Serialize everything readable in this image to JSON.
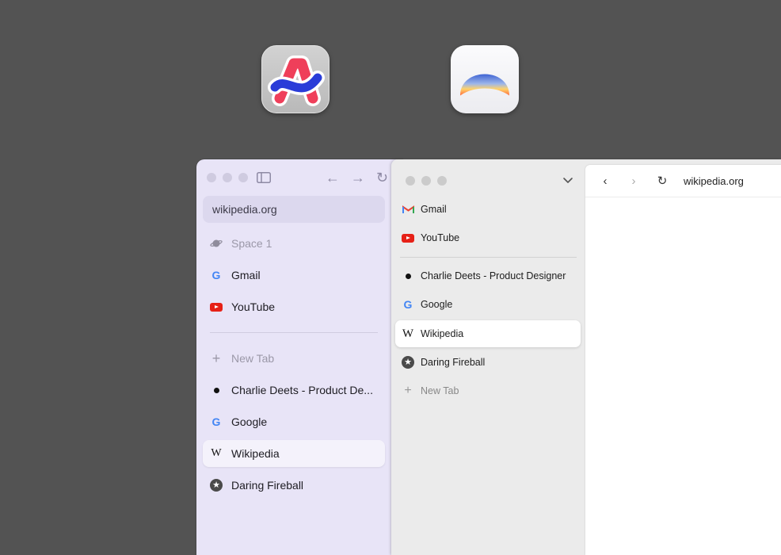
{
  "apps": {
    "arc_icon": "arc-logo-icon",
    "browser2_icon": "sunrise-logo-icon"
  },
  "win1": {
    "address": "wikipedia.org",
    "space": "Space 1",
    "pinned": [
      {
        "label": "Gmail",
        "icon": "google-icon"
      },
      {
        "label": "YouTube",
        "icon": "youtube-icon"
      }
    ],
    "new_tab": "New Tab",
    "tabs": [
      {
        "label": "Charlie Deets - Product De...",
        "icon": "bullet-icon"
      },
      {
        "label": "Google",
        "icon": "google-icon"
      },
      {
        "label": "Wikipedia",
        "icon": "wikipedia-icon",
        "selected": true
      },
      {
        "label": "Daring Fireball",
        "icon": "star-icon"
      }
    ]
  },
  "win2": {
    "pinned": [
      {
        "label": "Gmail",
        "icon": "gmail-icon"
      },
      {
        "label": "YouTube",
        "icon": "youtube-icon"
      }
    ],
    "tabs": [
      {
        "label": "Charlie Deets - Product Designer",
        "icon": "bullet-icon"
      },
      {
        "label": "Google",
        "icon": "google-icon"
      },
      {
        "label": "Wikipedia",
        "icon": "wikipedia-icon",
        "selected": true
      },
      {
        "label": "Daring Fireball",
        "icon": "star-icon"
      }
    ],
    "new_tab": "New Tab",
    "url": "wikipedia.org"
  }
}
